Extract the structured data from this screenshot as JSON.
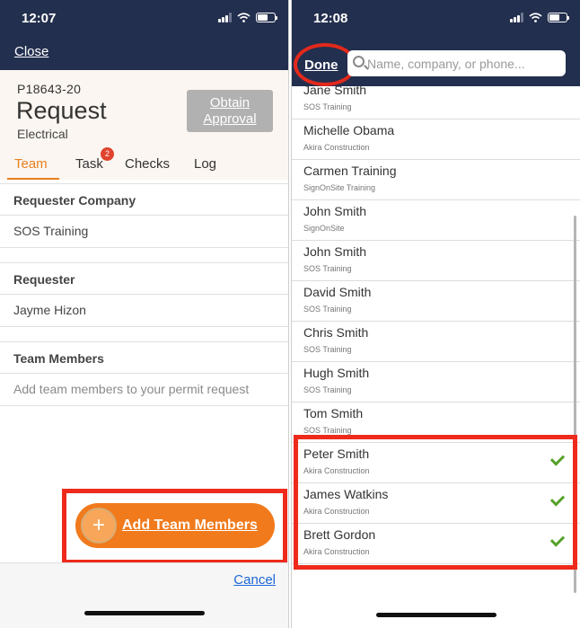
{
  "left_phone": {
    "status": {
      "time": "12:07"
    },
    "nav": {
      "close_label": "Close"
    },
    "permit": {
      "id": "P18643-20",
      "title": "Request",
      "subtitle": "Electrical",
      "obtain_button_line1": "Obtain",
      "obtain_button_line2": "Approval"
    },
    "tabs": [
      {
        "label": "Team",
        "active": true
      },
      {
        "label": "Task",
        "badge": "2"
      },
      {
        "label": "Checks"
      },
      {
        "label": "Log"
      }
    ],
    "sections": {
      "requester_company": {
        "heading": "Requester Company",
        "value": "SOS Training"
      },
      "requester": {
        "heading": "Requester",
        "value": "Jayme Hizon"
      },
      "team_members": {
        "heading": "Team Members",
        "placeholder": "Add team members to your permit request"
      }
    },
    "add_button": {
      "icon": "+",
      "label": "Add Team Members"
    },
    "footer": {
      "cancel_label": "Cancel"
    }
  },
  "right_phone": {
    "status": {
      "time": "12:08"
    },
    "nav": {
      "done_label": "Done"
    },
    "search": {
      "placeholder": "Name, company, or phone..."
    },
    "contacts": [
      {
        "name": "Jane Smith",
        "company": "SOS Training",
        "selected": false
      },
      {
        "name": "Michelle Obama",
        "company": "Akira Construction",
        "selected": false
      },
      {
        "name": "Carmen Training",
        "company": "SignOnSite Training",
        "selected": false
      },
      {
        "name": "John Smith",
        "company": "SignOnSite",
        "selected": false
      },
      {
        "name": "John Smith",
        "company": "SOS Training",
        "selected": false
      },
      {
        "name": "David Smith",
        "company": "SOS Training",
        "selected": false
      },
      {
        "name": "Chris Smith",
        "company": "SOS Training",
        "selected": false
      },
      {
        "name": "Hugh Smith",
        "company": "SOS Training",
        "selected": false
      },
      {
        "name": "Tom Smith",
        "company": "SOS Training",
        "selected": false
      },
      {
        "name": "Peter Smith",
        "company": "Akira Construction",
        "selected": true
      },
      {
        "name": "James Watkins",
        "company": "Akira Construction",
        "selected": true
      },
      {
        "name": "Brett Gordon",
        "company": "Akira Construction",
        "selected": true
      }
    ]
  },
  "colors": {
    "nav_bg": "#232f4e",
    "accent_orange": "#f07a1c",
    "highlight_red": "#ee2a1c",
    "check_green": "#56a12a",
    "link_blue": "#1c66d6"
  }
}
